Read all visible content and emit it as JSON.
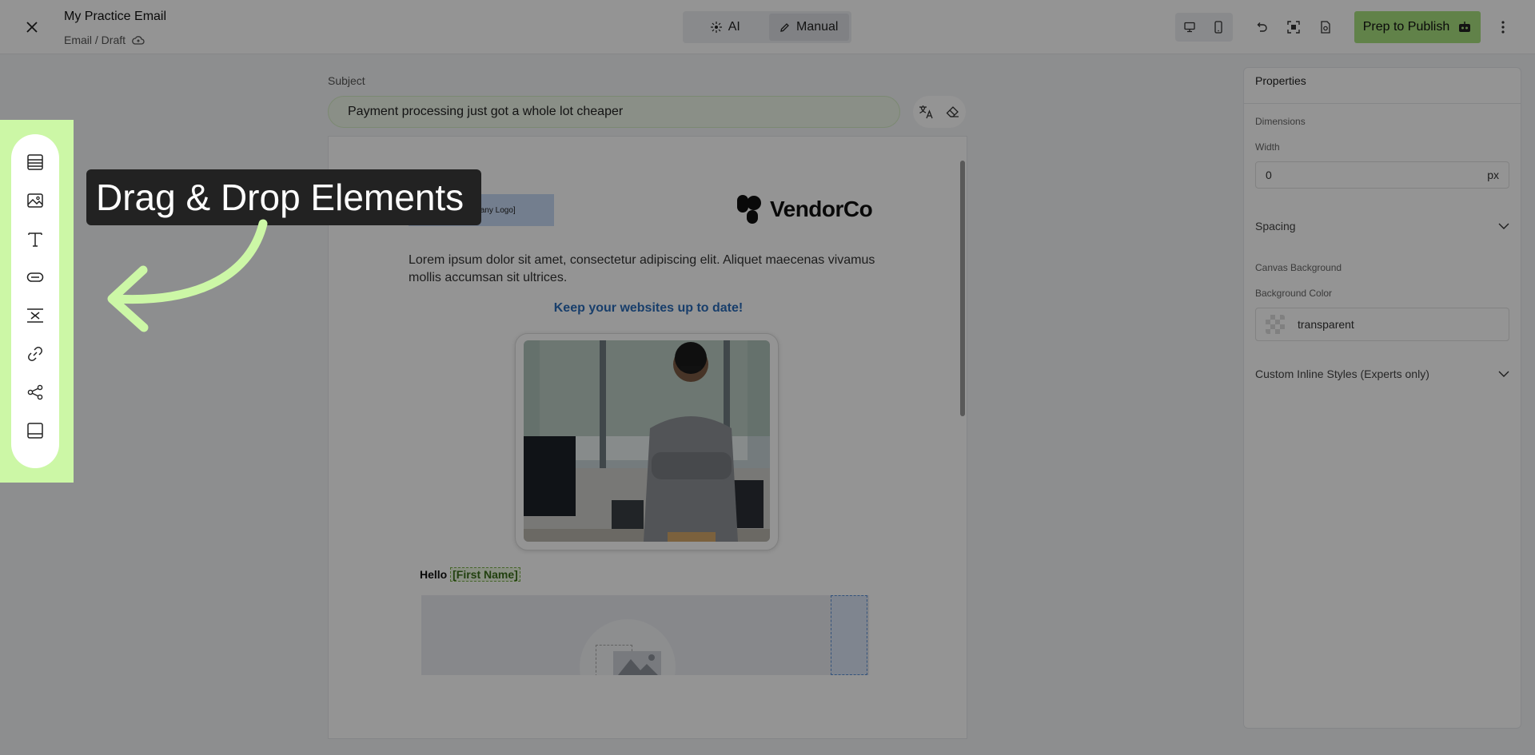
{
  "header": {
    "title": "My Practice Email",
    "breadcrumb": "Email / Draft",
    "modes": [
      {
        "label": "AI",
        "active": false
      },
      {
        "label": "Manual",
        "active": true
      }
    ],
    "publish_label": "Prep to Publish"
  },
  "toolbar": {
    "items": [
      "rows-icon",
      "image-icon",
      "text-icon",
      "button-icon",
      "spacer-icon",
      "link-icon",
      "social-share-icon",
      "footer-icon"
    ]
  },
  "tooltip": {
    "text": "Drag & Drop Elements"
  },
  "subject": {
    "label": "Subject",
    "value": "Payment processing just got a whole lot cheaper"
  },
  "email": {
    "logo_placeholder": "[Company Logo]",
    "brand_name": "VendorCo",
    "body_text": "Lorem ipsum dolor sit amet, consectetur adipiscing elit. Aliquet maecenas vivamus mollis accumsan sit ultrices.",
    "headline": "Keep your websites up to date!",
    "greeting": "Hello",
    "merge_tag": "[First Name]"
  },
  "properties": {
    "title": "Properties",
    "dimensions_label": "Dimensions",
    "width_label": "Width",
    "width_value": "0",
    "width_unit": "px",
    "spacing_label": "Spacing",
    "canvas_bg_label": "Canvas Background",
    "bg_color_label": "Background Color",
    "bg_color_value": "transparent",
    "custom_styles_label": "Custom Inline Styles (Experts only)"
  },
  "colors": {
    "accent_green": "#a8e07e",
    "highlight_green": "#ccf7a6",
    "headline_blue": "#2a6cb8"
  }
}
